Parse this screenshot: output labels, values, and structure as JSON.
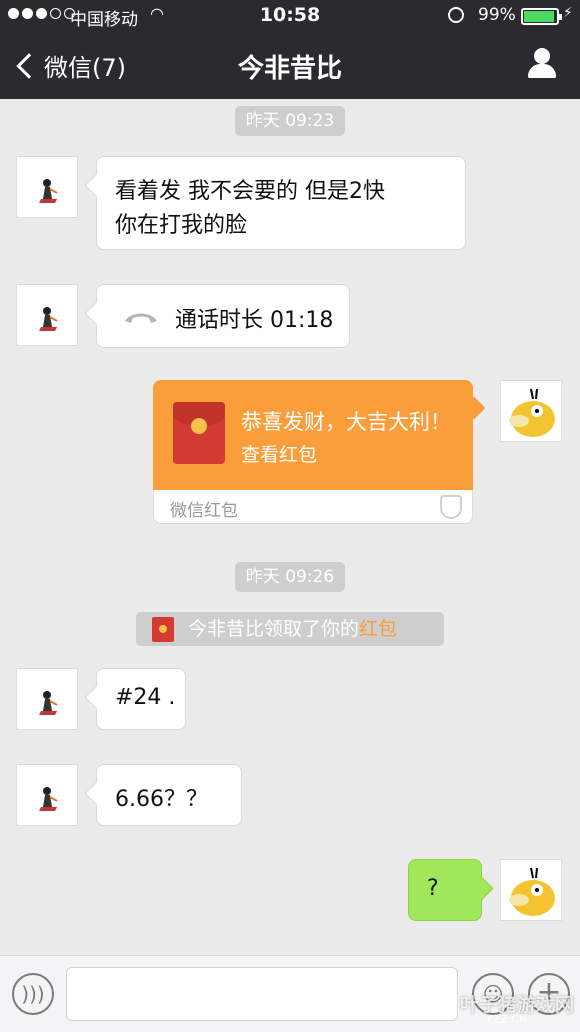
{
  "status_bar": {
    "carrier": "中国移动",
    "time": "10:58",
    "battery": "99%"
  },
  "nav": {
    "back_label": "微信(7)",
    "title": "今非昔比"
  },
  "messages": {
    "timestamp1": "昨天 09:23",
    "msg1_line1": "看着发  我不会要的 但是2快",
    "msg1_line2": "你在打我的脸",
    "call": "通话时长 01:18",
    "red_packet": {
      "title": "恭喜发财，大吉大利！",
      "action": "查看红包",
      "label": "微信红包"
    },
    "timestamp2": "昨天 09:26",
    "notice_prefix": "今非昔比领取了你的",
    "notice_link": "红包",
    "msg3": "#24 .",
    "msg4": "6.66？？",
    "msg5": "?"
  },
  "watermark": {
    "main": "叶子猪游戏网",
    "url": "YZZ.CN"
  },
  "colors": {
    "nav_bg": "#2b2b2f",
    "chat_bg": "#ebebeb",
    "sent_bubble": "#a0e75a",
    "red_packet": "#fa9d3b"
  }
}
